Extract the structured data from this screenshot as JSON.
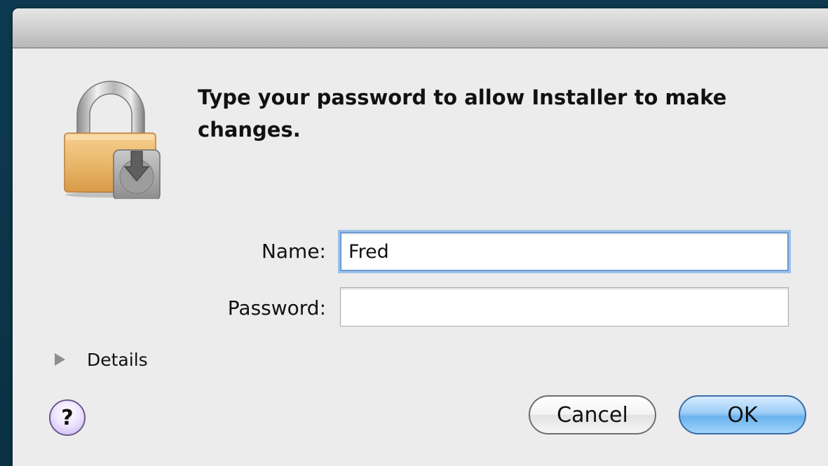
{
  "dialog": {
    "heading": "Type your password to allow Installer to make changes."
  },
  "form": {
    "name_label": "Name:",
    "name_value": "Fred",
    "password_label": "Password:",
    "password_value": ""
  },
  "details": {
    "label": "Details"
  },
  "buttons": {
    "help_label": "?",
    "cancel_label": "Cancel",
    "ok_label": "OK"
  },
  "icons": {
    "lock": "lock-installer-icon",
    "disclosure": "disclosure-triangle-right-icon"
  },
  "colors": {
    "default_button": "#6bb2ee",
    "focus_ring": "#9cc1ea",
    "help_button": "#c7b1f0",
    "desktop_background": "#0c3448"
  }
}
